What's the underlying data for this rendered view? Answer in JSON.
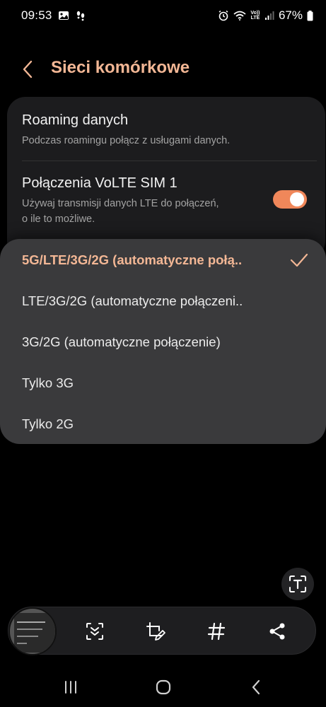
{
  "status_bar": {
    "time": "09:53",
    "volte_top": "Vo))",
    "volte_bottom": "LTE",
    "battery_percent": "67%"
  },
  "header": {
    "title": "Sieci komórkowe"
  },
  "settings": {
    "roaming": {
      "title": "Roaming danych",
      "subtitle": "Podczas roamingu połącz z usługami danych."
    },
    "volte": {
      "title": "Połączenia VoLTE SIM 1",
      "subtitle_line1": "Używaj transmisji danych LTE do połączeń,",
      "subtitle_line2": "o ile to możliwe.",
      "enabled": true
    }
  },
  "network_mode_options": [
    {
      "label": "5G/LTE/3G/2G (automatyczne połą..",
      "selected": true
    },
    {
      "label": "LTE/3G/2G (automatyczne połączeni..",
      "selected": false
    },
    {
      "label": "3G/2G (automatyczne połączenie)",
      "selected": false
    },
    {
      "label": "Tylko 3G",
      "selected": false
    },
    {
      "label": "Tylko 2G",
      "selected": false
    }
  ],
  "toolbar": {
    "icons": [
      "scroll-capture-icon",
      "edit-crop-icon",
      "hashtag-icon",
      "share-icon"
    ]
  },
  "colors": {
    "accent": "#f3b795",
    "toggle_on": "#f0875a",
    "card_bg": "#1c1c1e",
    "dropdown_bg": "#3a3a3c"
  }
}
